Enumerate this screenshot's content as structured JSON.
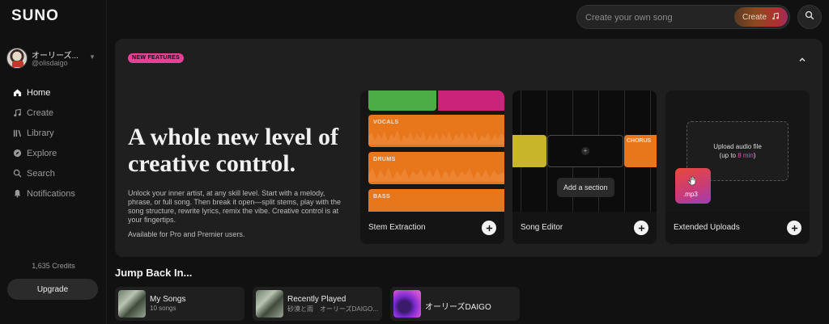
{
  "app": {
    "logo": "SUNO"
  },
  "profile": {
    "name": "オーリーズ...",
    "handle": "@olisdaigo"
  },
  "nav": {
    "items": [
      {
        "label": "Home",
        "icon": "home-icon"
      },
      {
        "label": "Create",
        "icon": "music-note-icon"
      },
      {
        "label": "Library",
        "icon": "library-icon"
      },
      {
        "label": "Explore",
        "icon": "compass-icon"
      },
      {
        "label": "Search",
        "icon": "search-icon"
      },
      {
        "label": "Notifications",
        "icon": "bell-icon"
      }
    ],
    "active": "Home"
  },
  "sidebar_footer": {
    "credits": "1,635 Credits",
    "upgrade_label": "Upgrade"
  },
  "top": {
    "create_placeholder": "Create your own song",
    "create_button": "Create"
  },
  "banner": {
    "badge": "NEW FEATURES",
    "headline": "A whole new level of creative control.",
    "description": "Unlock your inner artist, at any skill level. Start with a melody, phrase, or full song. Then break it open—split stems, play with the song structure, rewrite lyrics, remix the vibe. Creative control is at your fingertips.",
    "availability": "Available for Pro and Premier users.",
    "cards": [
      {
        "label": "Stem Extraction",
        "tracks": [
          "VOCALS",
          "DRUMS",
          "BASS"
        ]
      },
      {
        "label": "Song Editor",
        "section_label": "CHORUS",
        "add_section": "Add a section"
      },
      {
        "label": "Extended Uploads",
        "upload_title": "Upload audio file",
        "upload_sub_prefix": "(up to ",
        "upload_sub_highlight": "8 min",
        "upload_sub_suffix": ")",
        "file_label": ".mp3"
      }
    ]
  },
  "jump_back": {
    "title": "Jump Back In...",
    "tiles": [
      {
        "title": "My Songs",
        "subtitle": "10 songs"
      },
      {
        "title": "Recently Played",
        "subtitle": "砂漠と雨　オーリーズDAIGO..."
      },
      {
        "title": "オーリーズDAIGO",
        "subtitle": ""
      }
    ]
  },
  "colors": {
    "accent_pink": "#ea3f97",
    "track_orange": "#e8761b",
    "track_green": "#4cad47",
    "track_magenta": "#c9237a",
    "track_yellow": "#c9b52a"
  }
}
